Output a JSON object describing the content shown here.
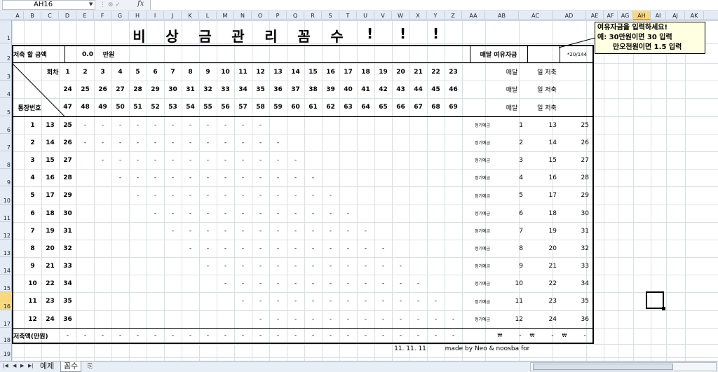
{
  "name_box": "AH16",
  "fx_label": "fx",
  "columns": [
    "A",
    "B",
    "C",
    "D",
    "E",
    "F",
    "G",
    "H",
    "I",
    "J",
    "K",
    "L",
    "M",
    "N",
    "O",
    "P",
    "Q",
    "R",
    "S",
    "T",
    "U",
    "V",
    "W",
    "X",
    "Y",
    "Z",
    "AA",
    "AB",
    "AC",
    "AD",
    "AE",
    "AF",
    "AG",
    "AH",
    "AI",
    "AJ",
    "AK"
  ],
  "rows": [
    "1",
    "2",
    "3",
    "4",
    "5",
    "6",
    "7",
    "8",
    "9",
    "10",
    "11",
    "12",
    "13",
    "14",
    "15",
    "16",
    "17",
    "18",
    "19"
  ],
  "title_chars": [
    "비",
    "상",
    "금",
    "관",
    "리",
    "꼼",
    "수",
    "!",
    "!",
    "!"
  ],
  "r2": {
    "label": "저축 할 금액",
    "amount": "0.0",
    "unit": "만원",
    "monthly_label": "매달 여유자금",
    "note": "*20/144"
  },
  "header_round": "회차",
  "header_bankbook": "통장번호",
  "rounds": [
    [
      "1",
      "2",
      "3",
      "4",
      "5",
      "6",
      "7",
      "8",
      "9",
      "10",
      "11",
      "12",
      "13",
      "14",
      "15",
      "16",
      "17",
      "18",
      "19",
      "20",
      "21",
      "22",
      "23"
    ],
    [
      "24",
      "25",
      "26",
      "27",
      "28",
      "29",
      "30",
      "31",
      "32",
      "33",
      "34",
      "35",
      "36",
      "37",
      "38",
      "39",
      "40",
      "41",
      "42",
      "43",
      "44",
      "45",
      "46"
    ],
    [
      "47",
      "48",
      "49",
      "50",
      "51",
      "52",
      "53",
      "54",
      "55",
      "56",
      "57",
      "58",
      "59",
      "60",
      "61",
      "62",
      "63",
      "64",
      "65",
      "66",
      "67",
      "68",
      "69"
    ]
  ],
  "right_header": {
    "monthly": "매달",
    "daily": "일 저축"
  },
  "bank_rows": [
    [
      "1",
      "13",
      "25"
    ],
    [
      "2",
      "14",
      "26"
    ],
    [
      "3",
      "15",
      "27"
    ],
    [
      "4",
      "16",
      "28"
    ],
    [
      "5",
      "17",
      "29"
    ],
    [
      "6",
      "18",
      "30"
    ],
    [
      "7",
      "19",
      "31"
    ],
    [
      "8",
      "20",
      "32"
    ],
    [
      "9",
      "21",
      "33"
    ],
    [
      "10",
      "22",
      "34"
    ],
    [
      "11",
      "23",
      "35"
    ],
    [
      "12",
      "24",
      "36"
    ]
  ],
  "deposit_label": "정기예금",
  "dash": "-",
  "won": "₩",
  "total_label": "저축액(만원)",
  "footer_date": "11. 11. 11",
  "footer_credit": "made by Neo & noosba for",
  "comment": [
    "여유자금을 입력하세요!",
    "예: 30만원이면 30 입력",
    "만오천원이면 1.5 입력"
  ],
  "tabs": [
    "예제",
    "꼼수"
  ]
}
